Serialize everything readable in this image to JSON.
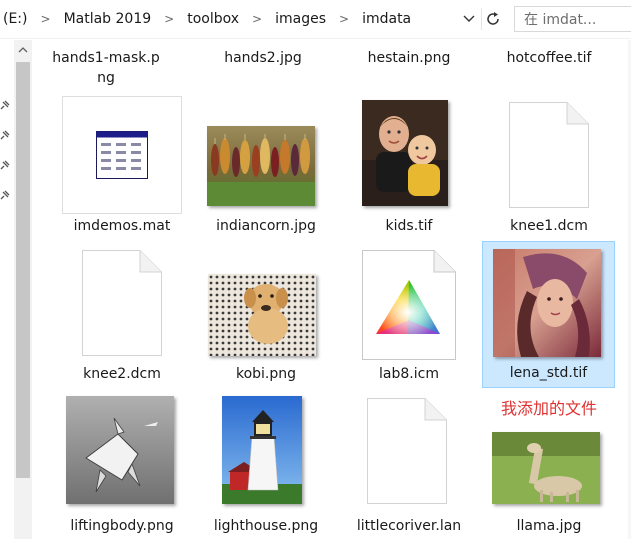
{
  "address": {
    "drive": "(E:)",
    "crumbs": [
      "Matlab 2019",
      "toolbox",
      "images",
      "imdata"
    ]
  },
  "search": {
    "placeholder": "在 imdat..."
  },
  "files_top_row": [
    {
      "name_line1": "hands1-mask.p",
      "name_line2": "ng"
    },
    {
      "name_line1": "hands2.jpg"
    },
    {
      "name_line1": "hestain.png"
    },
    {
      "name_line1": "hotcoffee.tif"
    }
  ],
  "files": [
    {
      "name": "imdemos.mat",
      "icon": "mat-table-icon"
    },
    {
      "name": "indiancorn.jpg",
      "icon": "image-thumbnail"
    },
    {
      "name": "kids.tif",
      "icon": "image-thumbnail"
    },
    {
      "name": "knee1.dcm",
      "icon": "blank-document-icon"
    },
    {
      "name": "knee2.dcm",
      "icon": "blank-document-icon"
    },
    {
      "name": "kobi.png",
      "icon": "image-thumbnail"
    },
    {
      "name": "lab8.icm",
      "icon": "color-profile-icon"
    },
    {
      "name": "lena_std.tif",
      "icon": "image-thumbnail",
      "selected": true
    },
    {
      "name": "liftingbody.png",
      "icon": "image-thumbnail"
    },
    {
      "name": "lighthouse.png",
      "icon": "image-thumbnail"
    },
    {
      "name": "littlecoriver.lan",
      "icon": "blank-document-icon"
    },
    {
      "name": "llama.jpg",
      "icon": "image-thumbnail"
    }
  ],
  "annotation": "我添加的文件",
  "colors": {
    "selection_bg": "#cce8ff",
    "selection_border": "#99d1ff",
    "annotation": "#e03131"
  }
}
